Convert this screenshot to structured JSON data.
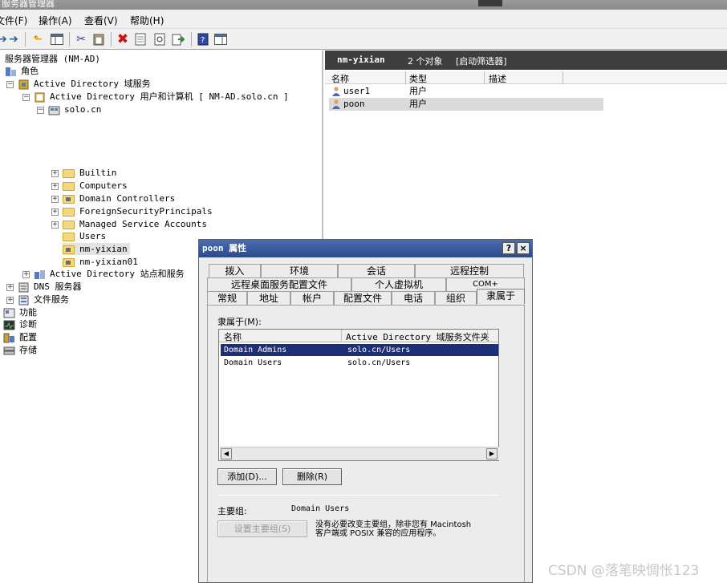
{
  "window": {
    "title": "服务器管理器"
  },
  "menu": [
    {
      "label": "文件(F)"
    },
    {
      "label": "操作(A)"
    },
    {
      "label": "查看(V)"
    },
    {
      "label": "帮助(H)"
    }
  ],
  "tree": {
    "root": "服务器管理器 (NM-AD)",
    "roles": "角色",
    "ad_ds": "Active Directory 域服务",
    "aduc": "Active Directory 用户和计算机 [ NM-AD.solo.cn ]",
    "domain": "solo.cn",
    "containers": [
      "Builtin",
      "Computers",
      "Domain Controllers",
      "ForeignSecurityPrincipals",
      "Managed Service Accounts",
      "Users",
      "nm-yixian",
      "nm-yixian01"
    ],
    "sites": "Active Directory 站点和服务",
    "dns": "DNS 服务器",
    "file": "文件服务",
    "features": "功能",
    "diagnostics": "诊断",
    "config": "配置",
    "storage": "存储"
  },
  "right_pane": {
    "header_name": "nm-yixian",
    "header_count": "2 个对象",
    "header_filter": "[启动筛选器]",
    "columns": [
      "名称",
      "类型",
      "描述"
    ],
    "rows": [
      {
        "name": "user1",
        "type": "用户",
        "selected": false
      },
      {
        "name": "poon",
        "type": "用户",
        "selected": true
      }
    ]
  },
  "dialog": {
    "title": "poon 属性",
    "help": "?",
    "close": "×",
    "tabs_row1": [
      "拨入",
      "环境",
      "会话",
      "远程控制"
    ],
    "tabs_row2": [
      "远程桌面服务配置文件",
      "个人虚拟机",
      "COM+"
    ],
    "tabs_row3": [
      "常规",
      "地址",
      "帐户",
      "配置文件",
      "电话",
      "组织",
      "隶属于"
    ],
    "member_of_label": "隶属于(M):",
    "list_columns": [
      "名称",
      "Active Directory 域服务文件夹"
    ],
    "groups": [
      {
        "name": "Domain Admins",
        "folder": "solo.cn/Users",
        "selected": true
      },
      {
        "name": "Domain Users",
        "folder": "solo.cn/Users",
        "selected": false
      }
    ],
    "add_button": "添加(D)...",
    "remove_button": "删除(R)",
    "primary_group_label": "主要组:",
    "primary_group_value": "Domain Users",
    "set_primary_button": "设置主要组(S)",
    "note_line1": "没有必要改变主要组，除非您有 Macintosh",
    "note_line2": "客户端或 POSIX 兼容的应用程序。"
  },
  "watermark": "CSDN @落笔映惆怅123"
}
